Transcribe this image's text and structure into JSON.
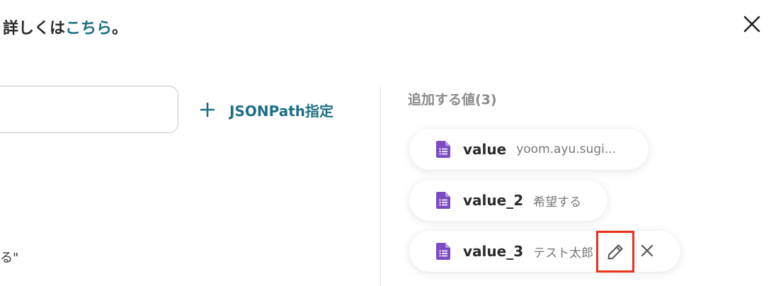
{
  "header": {
    "prefix": "詳しくは",
    "link": "こちら",
    "suffix": "。"
  },
  "input": {
    "value": ""
  },
  "jsonpath_button": {
    "label": "JSONPath指定"
  },
  "left_fragment": "る\"",
  "panel": {
    "title": "追加する値(3)",
    "items": [
      {
        "name": "value",
        "value": "yoom.ayu.sugi..."
      },
      {
        "name": "value_2",
        "value": "希望する"
      },
      {
        "name": "value_3",
        "value": "テスト太郎"
      }
    ]
  },
  "colors": {
    "link": "#1d6f86",
    "doc_icon": "#7b4bc4",
    "highlight": "#e8321c"
  },
  "icons": {
    "close": "close-icon",
    "plus": "plus-icon",
    "doc": "google-forms-icon",
    "edit": "pencil-icon",
    "remove": "x-icon"
  }
}
